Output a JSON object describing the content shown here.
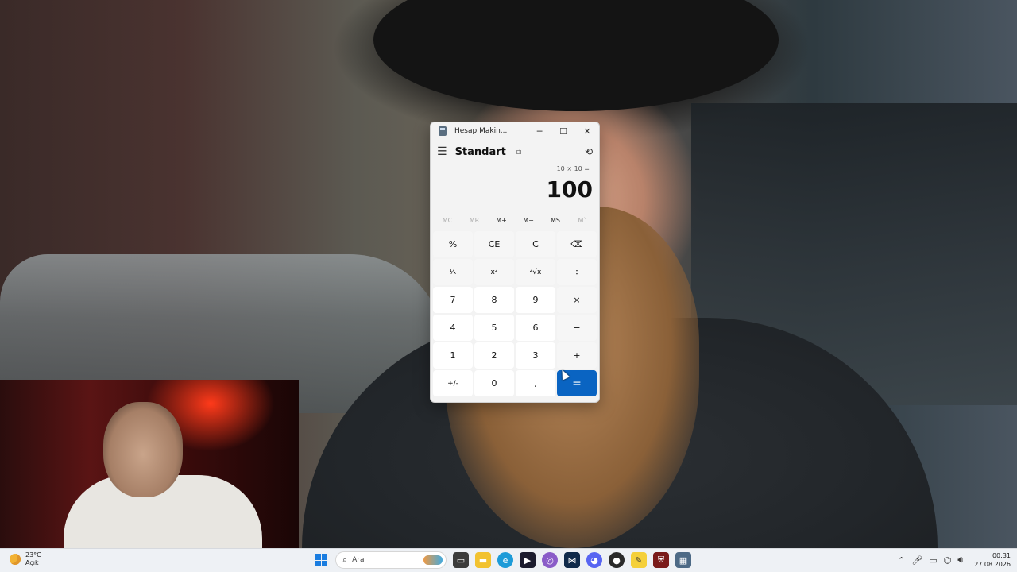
{
  "calculator": {
    "window_title": "Hesap Makin...",
    "mode": "Standart",
    "expression": "10 × 10 =",
    "result": "100",
    "memory_buttons": [
      {
        "label": "MC",
        "enabled": false
      },
      {
        "label": "MR",
        "enabled": false
      },
      {
        "label": "M+",
        "enabled": true
      },
      {
        "label": "M−",
        "enabled": true
      },
      {
        "label": "MS",
        "enabled": true
      },
      {
        "label": "M˅",
        "enabled": false
      }
    ],
    "keys": [
      "%",
      "CE",
      "C",
      "⌫",
      "¹⁄ₓ",
      "x²",
      "²√x",
      "÷",
      "7",
      "8",
      "9",
      "×",
      "4",
      "5",
      "6",
      "−",
      "1",
      "2",
      "3",
      "+",
      "+/-",
      "0",
      ",",
      "="
    ]
  },
  "taskbar": {
    "weather_temp": "23°C",
    "weather_desc": "Açık",
    "search_placeholder": "Ara",
    "time": "00:31",
    "date": "27.08.2026"
  },
  "colors": {
    "accent": "#0a64c2",
    "start": "#1a7de0"
  }
}
